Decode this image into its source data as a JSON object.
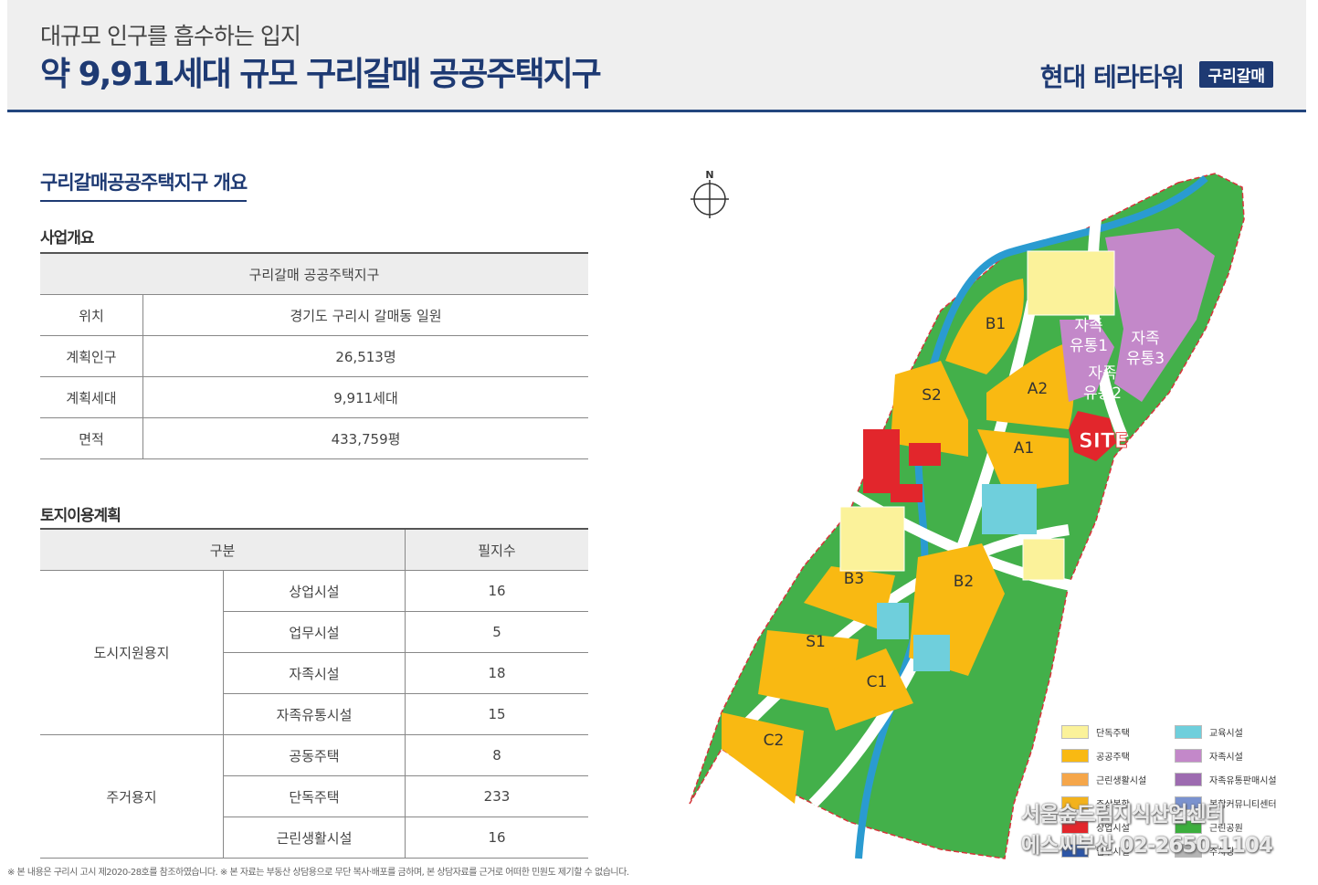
{
  "header": {
    "subtitle": "대규모 인구를 흡수하는 입지",
    "title": "약 9,911세대 규모 구리갈매 공공주택지구",
    "brand": "현대 테라타워",
    "brand_tag": "구리갈매"
  },
  "section_title": "구리갈매공공주택지구 개요",
  "overview": {
    "heading": "사업개요",
    "table_title": "구리갈매 공공주택지구",
    "rows": [
      {
        "key": "위치",
        "value": "경기도 구리시 갈매동 일원"
      },
      {
        "key": "계획인구",
        "value": "26,513명"
      },
      {
        "key": "계획세대",
        "value": "9,911세대"
      },
      {
        "key": "면적",
        "value": "433,759평"
      }
    ]
  },
  "landuse": {
    "heading": "토지이용계획",
    "col_category": "구분",
    "col_count": "필지수",
    "groups": [
      {
        "name": "도시지원용지",
        "items": [
          {
            "type": "상업시설",
            "count": "16"
          },
          {
            "type": "업무시설",
            "count": "5"
          },
          {
            "type": "자족시설",
            "count": "18"
          },
          {
            "type": "자족유통시설",
            "count": "15"
          }
        ]
      },
      {
        "name": "주거용지",
        "items": [
          {
            "type": "공동주택",
            "count": "8"
          },
          {
            "type": "단독주택",
            "count": "233"
          },
          {
            "type": "근린생활시설",
            "count": "16"
          }
        ]
      }
    ]
  },
  "footnote": "※ 본 내용은 구리시 고시 제2020-28호를 참조하였습니다. ※ 본 자료는 부동산 상담용으로 무단 복사·배포를 금하며, 본 상담자료를 근거로 어떠한 민원도 제기할 수 없습니다.",
  "map": {
    "north": "N",
    "site": "SITE",
    "labels": {
      "B1": "B1",
      "A2": "A2",
      "A1": "A1",
      "S2": "S2",
      "B3": "B3",
      "B2": "B2",
      "S1": "S1",
      "C1": "C1",
      "C2": "C2",
      "z1a": "자족",
      "z1b": "유통1",
      "z2a": "자족",
      "z2b": "유통2",
      "z3a": "자족",
      "z3b": "유통3"
    },
    "legend": [
      {
        "label": "단독주택",
        "color": "#fbf29a"
      },
      {
        "label": "교육시설",
        "color": "#6fcfdc"
      },
      {
        "label": "공공주택",
        "color": "#f9b912"
      },
      {
        "label": "자족시설",
        "color": "#c388c9"
      },
      {
        "label": "근린생활시설",
        "color": "#f5a64a"
      },
      {
        "label": "자족유통판매시설",
        "color": "#9d6bb0"
      },
      {
        "label": "주상복합",
        "color": "#f3b21c"
      },
      {
        "label": "복합커뮤니티센터",
        "color": "#7a92cf"
      },
      {
        "label": "상업시설",
        "color": "#e2262c"
      },
      {
        "label": "근린공원",
        "color": "#3cae3d"
      },
      {
        "label": "업무시설",
        "color": "#2d56a6"
      },
      {
        "label": "주차장",
        "color": "#b5b5b5"
      }
    ],
    "watermark_line1": "서울숲드림지식산업센터",
    "watermark_line2": "에스씨부산 02-2650-1104"
  }
}
